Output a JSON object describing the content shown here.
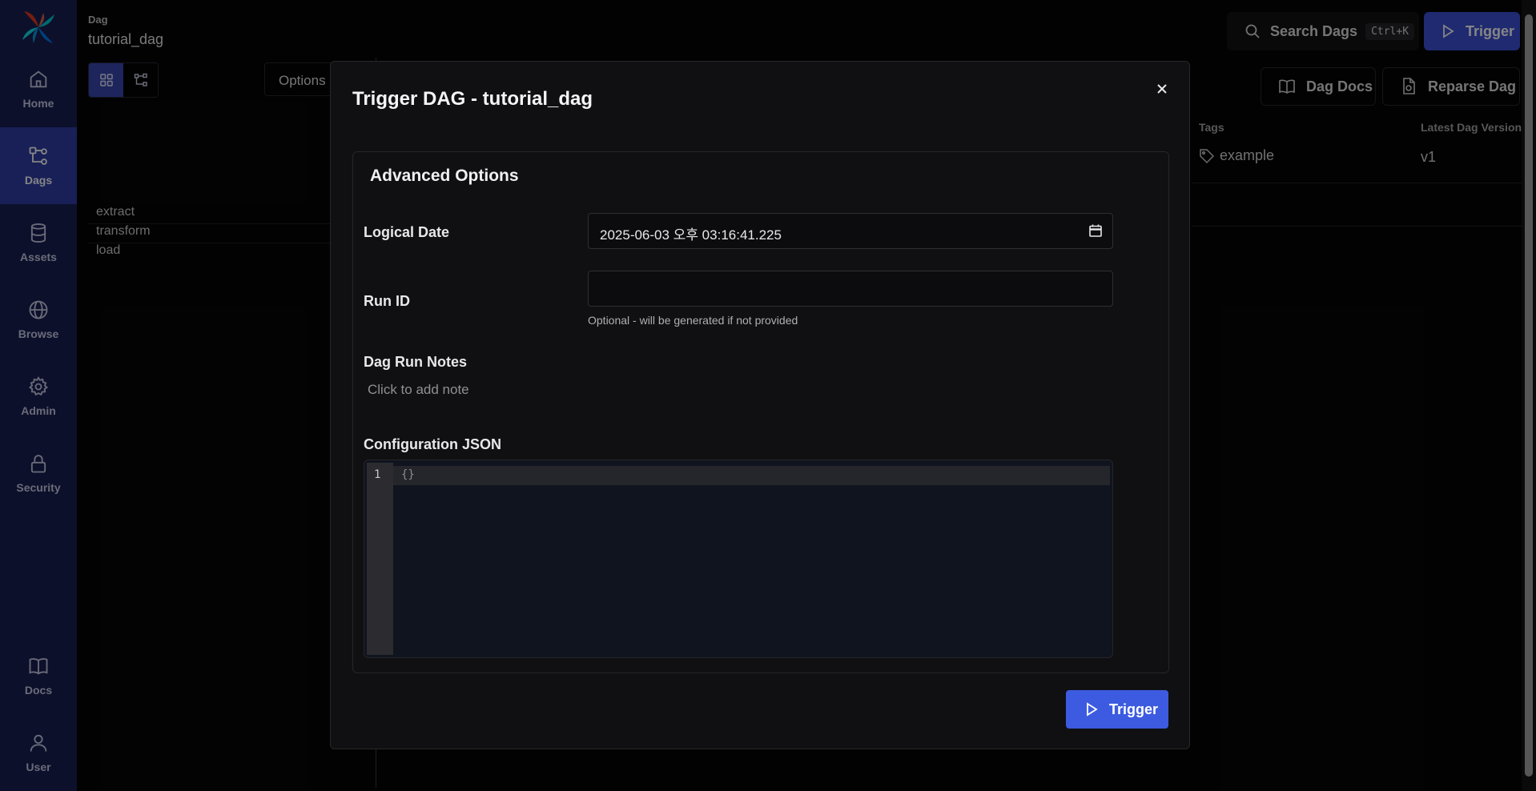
{
  "sidebar": {
    "items": [
      {
        "label": "Home",
        "icon": "home-icon"
      },
      {
        "label": "Dags",
        "icon": "dags-icon",
        "active": true
      },
      {
        "label": "Assets",
        "icon": "database-icon"
      },
      {
        "label": "Browse",
        "icon": "globe-icon"
      },
      {
        "label": "Admin",
        "icon": "gear-icon"
      },
      {
        "label": "Security",
        "icon": "lock-icon"
      }
    ],
    "bottom_items": [
      {
        "label": "Docs",
        "icon": "book-icon"
      },
      {
        "label": "User",
        "icon": "user-icon"
      }
    ]
  },
  "header": {
    "breadcrumb_label": "Dag",
    "dag_id": "tutorial_dag",
    "search_label": "Search Dags",
    "search_shortcut": "Ctrl+K",
    "trigger_label": "Trigger",
    "dag_docs_label": "Dag Docs",
    "reparse_label": "Reparse Dag"
  },
  "graph": {
    "options_label": "Options",
    "tasks": [
      "extract",
      "transform",
      "load"
    ]
  },
  "details": {
    "tags_header": "Tags",
    "version_header": "Latest Dag Version",
    "tag": "example",
    "version": "v1"
  },
  "modal": {
    "title": "Trigger DAG - tutorial_dag",
    "advanced_title": "Advanced Options",
    "logical_date_label": "Logical Date",
    "logical_date_value": "2025-06-03 오후 03:16:41.225",
    "run_id_label": "Run ID",
    "run_id_value": "",
    "run_id_hint": "Optional - will be generated if not provided",
    "notes_label": "Dag Run Notes",
    "notes_placeholder": "Click to add note",
    "config_label": "Configuration JSON",
    "config_line_number": "1",
    "config_value": "{}",
    "submit_label": "Trigger"
  },
  "colors": {
    "sidebar_bg": "#1a2054",
    "active_nav": "#2f3fa8",
    "primary": "#3d5be0",
    "background": "#050505"
  }
}
